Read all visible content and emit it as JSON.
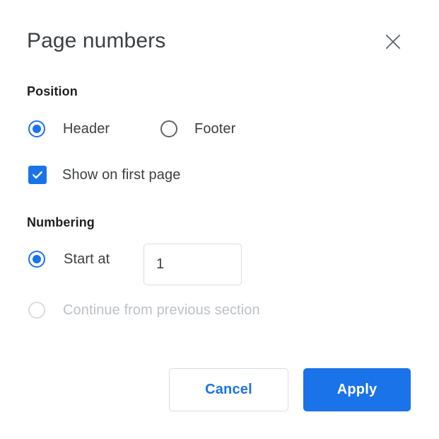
{
  "dialog": {
    "title": "Page numbers",
    "close_icon": "close-icon"
  },
  "position_section": {
    "heading": "Position",
    "options": [
      {
        "label": "Header",
        "selected": true
      },
      {
        "label": "Footer",
        "selected": false
      }
    ],
    "checkbox": {
      "label": "Show on first page",
      "checked": true
    }
  },
  "numbering_section": {
    "heading": "Numbering",
    "options": [
      {
        "label": "Start at",
        "selected": true,
        "disabled": false
      },
      {
        "label": "Continue from previous section",
        "selected": false,
        "disabled": true
      }
    ],
    "start_at_value": "1",
    "start_at_placeholder": ""
  },
  "footer": {
    "cancel_label": "Cancel",
    "apply_label": "Apply"
  },
  "colors": {
    "accent": "#1a73e8",
    "text_primary": "#202124",
    "text_secondary": "#3c4043",
    "text_disabled": "#bdc1c6",
    "border": "#dadce0",
    "radio_unchecked": "#5f6368",
    "background": "#ffffff"
  }
}
